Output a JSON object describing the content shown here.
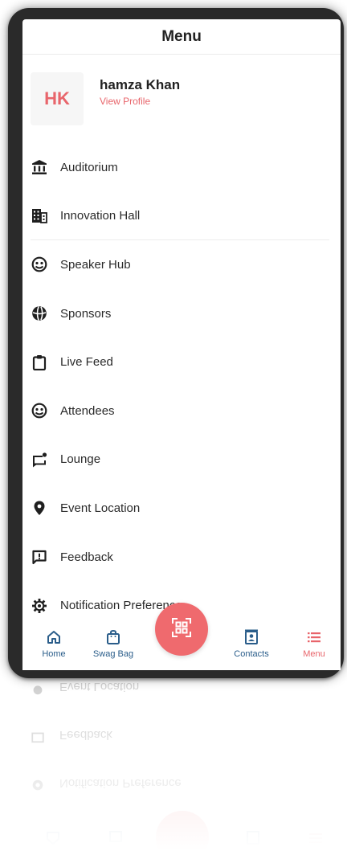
{
  "header": {
    "title": "Menu"
  },
  "profile": {
    "initials": "HK",
    "name": "hamza Khan",
    "link": "View Profile"
  },
  "menu": {
    "items": [
      {
        "label": "Auditorium",
        "icon": "auditorium-icon"
      },
      {
        "label": "Innovation Hall",
        "icon": "building-icon"
      },
      {
        "label": "Speaker Hub",
        "icon": "speaker-face-icon"
      },
      {
        "label": "Sponsors",
        "icon": "sponsor-ball-icon"
      },
      {
        "label": "Live Feed",
        "icon": "clipboard-icon"
      },
      {
        "label": "Attendees",
        "icon": "attendee-face-icon"
      },
      {
        "label": "Lounge",
        "icon": "lounge-chat-icon"
      },
      {
        "label": "Event Location",
        "icon": "location-pin-icon"
      },
      {
        "label": "Feedback",
        "icon": "feedback-icon"
      },
      {
        "label": "Notification Preference",
        "icon": "gear-icon"
      }
    ]
  },
  "bottom_nav": {
    "items": [
      {
        "label": "Home",
        "icon": "home-icon"
      },
      {
        "label": "Swag Bag",
        "icon": "bag-icon"
      },
      {
        "label": "Contacts",
        "icon": "contacts-icon"
      },
      {
        "label": "Menu",
        "icon": "menu-list-icon",
        "active": true
      }
    ],
    "scan_icon": "qr-scan-icon"
  },
  "colors": {
    "accent": "#e8656b",
    "scan_button": "#ef6a6e",
    "nav_text": "#2a5d8a",
    "icon": "#1f1f1f",
    "frame": "#2a2a2a"
  }
}
